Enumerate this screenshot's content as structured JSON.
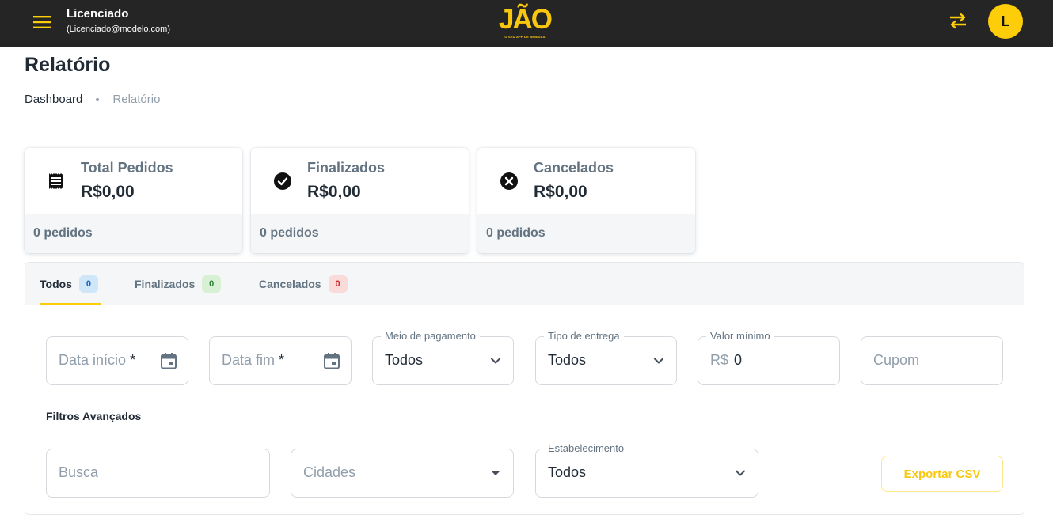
{
  "header": {
    "user_name": "Licenciado",
    "user_email": "(Licenciado@modelo.com)",
    "logo_text": "JÃO",
    "logo_tagline": "O SEU APP DE BEBIDAS",
    "avatar_initial": "L",
    "accent_color": "#fecd0a"
  },
  "page": {
    "title": "Relatório",
    "breadcrumb": [
      "Dashboard",
      "Relatório"
    ]
  },
  "cards": [
    {
      "label": "Total Pedidos",
      "value": "R$0,00",
      "footer": "0 pedidos",
      "icon": "receipt-icon"
    },
    {
      "label": "Finalizados",
      "value": "R$0,00",
      "footer": "0 pedidos",
      "icon": "check-circle-icon"
    },
    {
      "label": "Cancelados",
      "value": "R$0,00",
      "footer": "0 pedidos",
      "icon": "cancel-circle-icon"
    }
  ],
  "tabs": [
    {
      "label": "Todos",
      "count": "0",
      "badge_bg": "#d0e7fa",
      "badge_fg": "#1565c0"
    },
    {
      "label": "Finalizados",
      "count": "0",
      "badge_bg": "#d8f0d4",
      "badge_fg": "#2e7d32"
    },
    {
      "label": "Cancelados",
      "count": "0",
      "badge_bg": "#fbdada",
      "badge_fg": "#c62828"
    }
  ],
  "filters": {
    "date_start": {
      "placeholder": "Data início",
      "required_mark": "*"
    },
    "date_end": {
      "placeholder": "Data fim",
      "required_mark": "*"
    },
    "payment": {
      "label": "Meio de pagamento",
      "value": "Todos"
    },
    "delivery": {
      "label": "Tipo de entrega",
      "value": "Todos"
    },
    "min_value": {
      "label": "Valor mínimo",
      "prefix": "R$",
      "value": "0"
    },
    "coupon": {
      "placeholder": "Cupom"
    }
  },
  "advanced": {
    "title": "Filtros Avançados",
    "search": {
      "placeholder": "Busca"
    },
    "cities": {
      "placeholder": "Cidades"
    },
    "establishment": {
      "label": "Estabelecimento",
      "value": "Todos"
    },
    "export_label": "Exportar CSV"
  }
}
